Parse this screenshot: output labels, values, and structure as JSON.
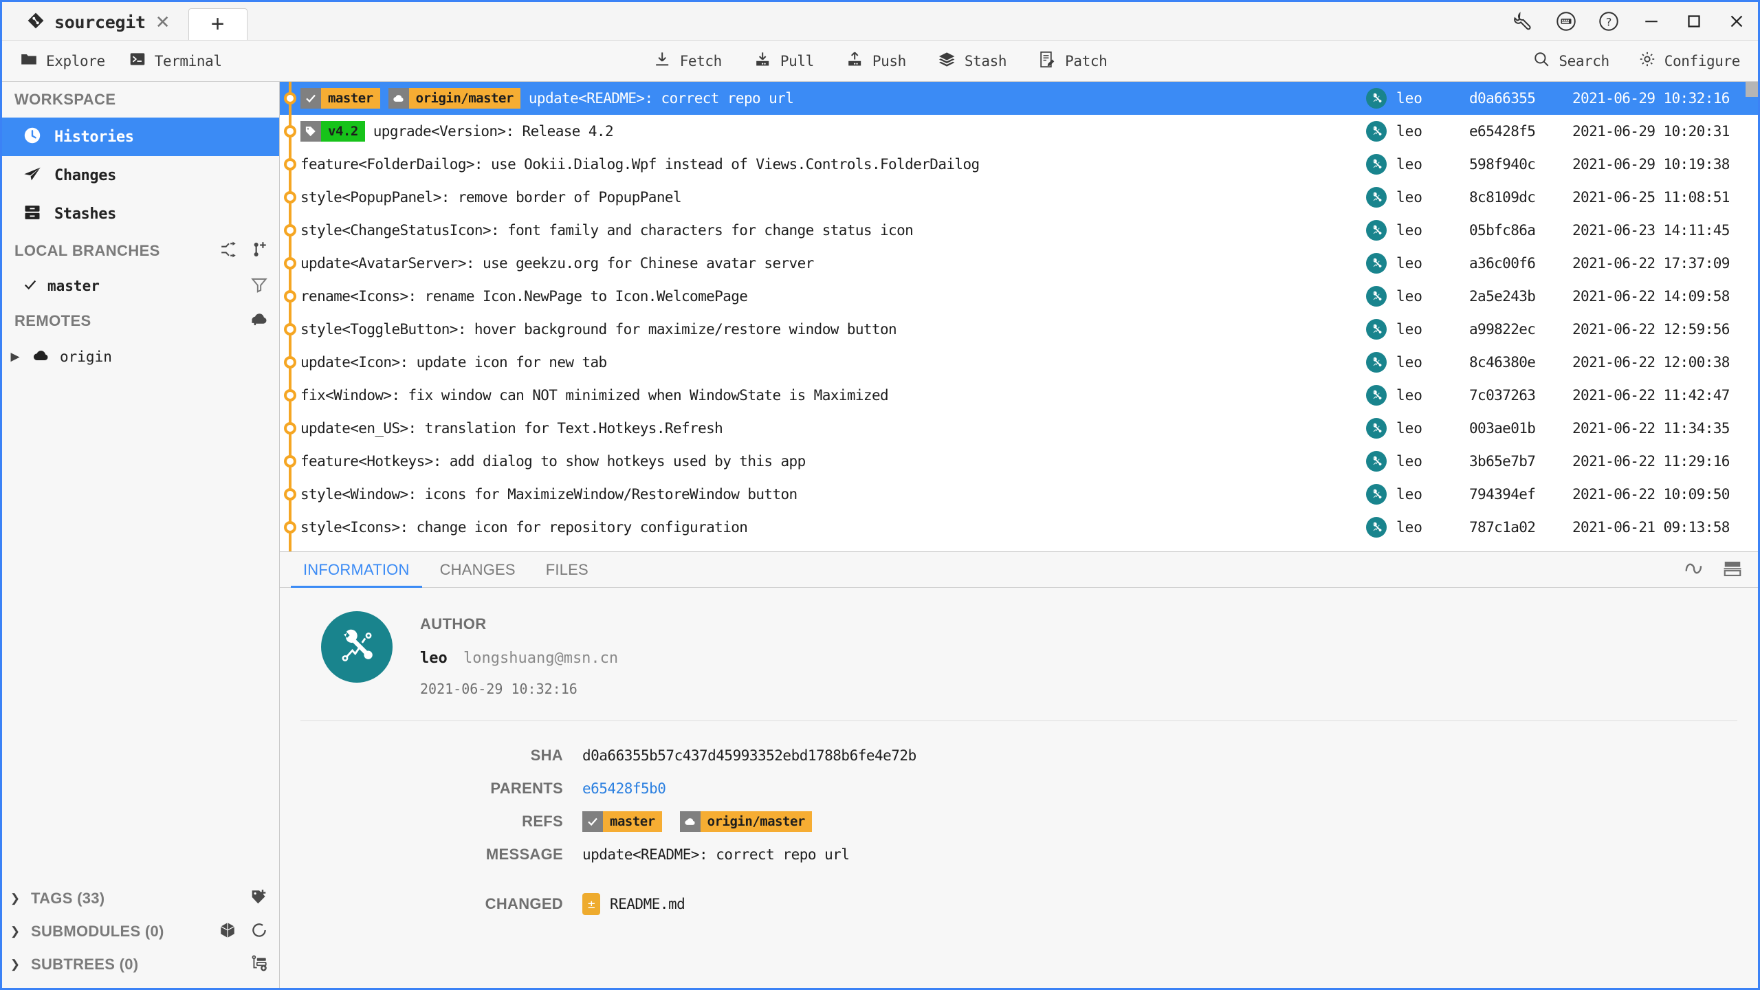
{
  "window": {
    "tab_title": "sourcegit",
    "tab_close": "✕",
    "new_tab": "+",
    "controls": [
      "wrench-icon",
      "keyboard-icon",
      "help-icon",
      "minimize-icon",
      "maximize-icon",
      "close-icon"
    ]
  },
  "toolbar": {
    "left": [
      {
        "label": "Explore",
        "icon": "folder-icon"
      },
      {
        "label": "Terminal",
        "icon": "terminal-icon"
      }
    ],
    "center": [
      {
        "label": "Fetch",
        "icon": "fetch-icon"
      },
      {
        "label": "Pull",
        "icon": "pull-icon"
      },
      {
        "label": "Push",
        "icon": "push-icon"
      },
      {
        "label": "Stash",
        "icon": "stash-icon"
      },
      {
        "label": "Patch",
        "icon": "patch-icon"
      }
    ],
    "right": [
      {
        "label": "Search",
        "icon": "search-icon"
      },
      {
        "label": "Configure",
        "icon": "gear-icon"
      }
    ]
  },
  "sidebar": {
    "workspace_header": "WORKSPACE",
    "workspace_items": [
      {
        "label": "Histories",
        "icon": "clock-icon",
        "active": true
      },
      {
        "label": "Changes",
        "icon": "paper-plane-icon",
        "active": false
      },
      {
        "label": "Stashes",
        "icon": "drawer-icon",
        "active": false
      }
    ],
    "local_branches_header": "LOCAL BRANCHES",
    "local_branches": [
      {
        "label": "master",
        "checked": true
      }
    ],
    "remotes_header": "REMOTES",
    "remotes": [
      {
        "label": "origin"
      }
    ],
    "collapsed": [
      {
        "label": "TAGS (33)",
        "icons": [
          "add-tag-icon"
        ]
      },
      {
        "label": "SUBMODULES (0)",
        "icons": [
          "cube-icon",
          "refresh-icon"
        ]
      },
      {
        "label": "SUBTREES (0)",
        "icons": [
          "add-subtree-icon"
        ]
      }
    ]
  },
  "commits": [
    {
      "subject": "update<README>: correct repo url",
      "author": "leo",
      "sha": "d0a66355",
      "time": "2021-06-29 10:32:16",
      "selected": true,
      "decorators": [
        {
          "kind": "branch",
          "text": "master",
          "icon": "check-icon"
        },
        {
          "kind": "branch",
          "text": "origin/master",
          "icon": "cloud-icon"
        }
      ]
    },
    {
      "subject": "upgrade<Version>: Release 4.2",
      "author": "leo",
      "sha": "e65428f5",
      "time": "2021-06-29 10:20:31",
      "selected": false,
      "decorators": [
        {
          "kind": "tag",
          "text": "v4.2",
          "icon": "tag-icon"
        }
      ]
    },
    {
      "subject": "feature<FolderDailog>: use Ookii.Dialog.Wpf instead of Views.Controls.FolderDailog",
      "author": "leo",
      "sha": "598f940c",
      "time": "2021-06-29 10:19:38",
      "selected": false,
      "decorators": []
    },
    {
      "subject": "style<PopupPanel>: remove border of PopupPanel",
      "author": "leo",
      "sha": "8c8109dc",
      "time": "2021-06-25 11:08:51",
      "selected": false,
      "decorators": []
    },
    {
      "subject": "style<ChangeStatusIcon>: font family and characters for change status icon",
      "author": "leo",
      "sha": "05bfc86a",
      "time": "2021-06-23 14:11:45",
      "selected": false,
      "decorators": []
    },
    {
      "subject": "update<AvatarServer>: use geekzu.org for Chinese avatar server",
      "author": "leo",
      "sha": "a36c00f6",
      "time": "2021-06-22 17:37:09",
      "selected": false,
      "decorators": []
    },
    {
      "subject": "rename<Icons>: rename Icon.NewPage to Icon.WelcomePage",
      "author": "leo",
      "sha": "2a5e243b",
      "time": "2021-06-22 14:09:58",
      "selected": false,
      "decorators": []
    },
    {
      "subject": "style<ToggleButton>: hover background for maximize/restore window button",
      "author": "leo",
      "sha": "a99822ec",
      "time": "2021-06-22 12:59:56",
      "selected": false,
      "decorators": []
    },
    {
      "subject": "update<Icon>: update icon for new tab",
      "author": "leo",
      "sha": "8c46380e",
      "time": "2021-06-22 12:00:38",
      "selected": false,
      "decorators": []
    },
    {
      "subject": "fix<Window>: fix window can NOT minimized when WindowState is Maximized",
      "author": "leo",
      "sha": "7c037263",
      "time": "2021-06-22 11:42:47",
      "selected": false,
      "decorators": []
    },
    {
      "subject": "update<en_US>: translation for Text.Hotkeys.Refresh",
      "author": "leo",
      "sha": "003ae01b",
      "time": "2021-06-22 11:34:35",
      "selected": false,
      "decorators": []
    },
    {
      "subject": "feature<Hotkeys>: add dialog to show hotkeys used by this app",
      "author": "leo",
      "sha": "3b65e7b7",
      "time": "2021-06-22 11:29:16",
      "selected": false,
      "decorators": []
    },
    {
      "subject": "style<Window>: icons for MaximizeWindow/RestoreWindow button",
      "author": "leo",
      "sha": "794394ef",
      "time": "2021-06-22 10:09:50",
      "selected": false,
      "decorators": []
    },
    {
      "subject": "style<Icons>: change icon for repository configuration",
      "author": "leo",
      "sha": "787c1a02",
      "time": "2021-06-21 09:13:58",
      "selected": false,
      "decorators": []
    }
  ],
  "detail": {
    "tabs": [
      {
        "label": "INFORMATION",
        "active": true
      },
      {
        "label": "CHANGES",
        "active": false
      },
      {
        "label": "FILES",
        "active": false
      }
    ],
    "tab_icons": [
      "wave-icon",
      "layout-icon"
    ],
    "author_label": "AUTHOR",
    "author_name": "leo",
    "author_email": "longshuang@msn.cn",
    "author_date": "2021-06-29 10:32:16",
    "rows": [
      {
        "key": "SHA",
        "value": "d0a66355b57c437d45993352ebd1788b6fe4e72b",
        "type": "text"
      },
      {
        "key": "PARENTS",
        "value": "e65428f5b0",
        "type": "link"
      },
      {
        "key": "REFS",
        "value": "",
        "type": "refs"
      },
      {
        "key": "MESSAGE",
        "value": "update<README>: correct repo url",
        "type": "text"
      }
    ],
    "refs": [
      {
        "kind": "branch",
        "text": "master",
        "icon": "check-icon"
      },
      {
        "kind": "branch",
        "text": "origin/master",
        "icon": "cloud-icon"
      }
    ],
    "changed_label": "CHANGED",
    "changed_files": [
      {
        "name": "README.md",
        "status": "±"
      }
    ]
  },
  "colors": {
    "accent": "#3b8bf5",
    "branch_badge": "#f6ad33",
    "tag_badge": "#17c31a",
    "graph": "#f5a623",
    "avatar": "#19848d",
    "file_badge": "#eeab2e"
  }
}
